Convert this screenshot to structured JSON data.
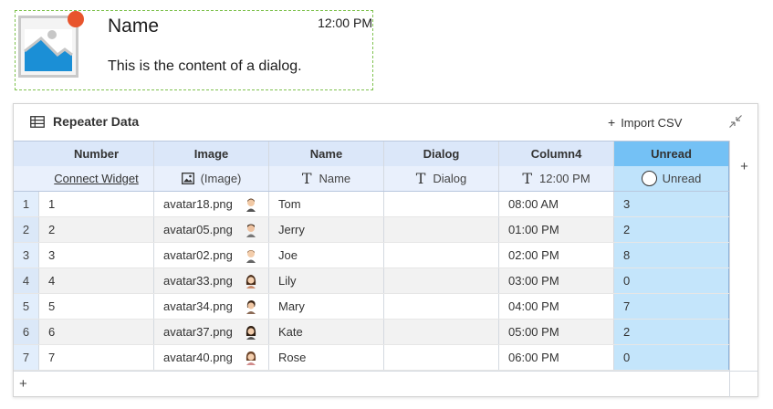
{
  "dialog": {
    "name": "Name",
    "time": "12:00 PM",
    "content": "This is the content of a dialog.",
    "colors": {
      "badge": "#e8542c",
      "image": "#1b8fd6",
      "border": "#7fc24f"
    }
  },
  "panel": {
    "title": "Repeater Data",
    "import_label": "Import CSV"
  },
  "columns": [
    {
      "header": "Number",
      "binding": "Connect Widget",
      "type_icon": "none"
    },
    {
      "header": "Image",
      "binding": "(Image)",
      "type_icon": "image-icon"
    },
    {
      "header": "Name",
      "binding": "Name",
      "type_icon": "text-type-icon"
    },
    {
      "header": "Dialog",
      "binding": "Dialog",
      "type_icon": "text-type-icon"
    },
    {
      "header": "Column4",
      "binding": "12:00 PM",
      "type_icon": "text-type-icon"
    },
    {
      "header": "Unread",
      "binding": "Unread",
      "type_icon": "radio-icon"
    }
  ],
  "rows": [
    {
      "index": "1",
      "number": "1",
      "image": "avatar18.png",
      "name": "Tom",
      "dialog": "",
      "column4": "08:00 AM",
      "unread": "3"
    },
    {
      "index": "2",
      "number": "2",
      "image": "avatar05.png",
      "name": "Jerry",
      "dialog": "",
      "column4": "01:00 PM",
      "unread": "2"
    },
    {
      "index": "3",
      "number": "3",
      "image": "avatar02.png",
      "name": "Joe",
      "dialog": "",
      "column4": "02:00 PM",
      "unread": "8"
    },
    {
      "index": "4",
      "number": "4",
      "image": "avatar33.png",
      "name": "Lily",
      "dialog": "",
      "column4": "03:00 PM",
      "unread": "0"
    },
    {
      "index": "5",
      "number": "5",
      "image": "avatar34.png",
      "name": "Mary",
      "dialog": "",
      "column4": "04:00 PM",
      "unread": "7"
    },
    {
      "index": "6",
      "number": "6",
      "image": "avatar37.png",
      "name": "Kate",
      "dialog": "",
      "column4": "05:00 PM",
      "unread": "2"
    },
    {
      "index": "7",
      "number": "7",
      "image": "avatar40.png",
      "name": "Rose",
      "dialog": "",
      "column4": "06:00 PM",
      "unread": "0"
    }
  ],
  "controls": {
    "add_column": "+",
    "add_row": "+"
  },
  "colors": {
    "header_bg": "#dbe7f9",
    "subheader_bg": "#e9f0fc",
    "selected_col_header": "#74c1f5",
    "selected_col_cell": "#c4e5fb"
  }
}
